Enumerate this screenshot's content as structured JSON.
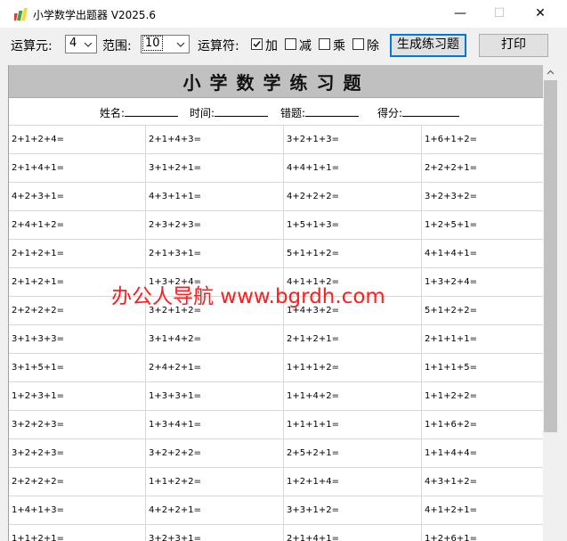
{
  "window": {
    "title": "小学数学出题器 V2025.6",
    "minimize": "—",
    "maximize": "☐",
    "close": "✕"
  },
  "toolbar": {
    "operands_label": "运算元:",
    "operands_value": "4",
    "range_label": "范围:",
    "range_value": "10",
    "operators_label": "运算符:",
    "ops": [
      {
        "label": "加",
        "checked": true
      },
      {
        "label": "减",
        "checked": false
      },
      {
        "label": "乘",
        "checked": false
      },
      {
        "label": "除",
        "checked": false
      }
    ],
    "generate_label": "生成练习题",
    "print_label": "打印"
  },
  "sheet": {
    "title": "小学数学练习题",
    "name_label": "姓名:",
    "time_label": "时间:",
    "errors_label": "错题:",
    "score_label": "得分:",
    "rows": [
      [
        "2+1+2+4=",
        "2+1+4+3=",
        "3+2+1+3=",
        "1+6+1+2="
      ],
      [
        "2+1+4+1=",
        "3+1+2+1=",
        "4+4+1+1=",
        "2+2+2+1="
      ],
      [
        "4+2+3+1=",
        "4+3+1+1=",
        "4+2+2+2=",
        "3+2+3+2="
      ],
      [
        "2+4+1+2=",
        "2+3+2+3=",
        "1+5+1+3=",
        "1+2+5+1="
      ],
      [
        "2+1+2+1=",
        "2+1+3+1=",
        "5+1+1+2=",
        "4+1+4+1="
      ],
      [
        "2+1+2+1=",
        "1+3+2+4=",
        "4+1+1+2=",
        "1+3+2+4="
      ],
      [
        "2+2+2+2=",
        "3+2+1+2=",
        "1+4+3+2=",
        "5+1+2+2="
      ],
      [
        "3+1+3+3=",
        "3+1+4+2=",
        "2+1+2+1=",
        "2+1+1+1="
      ],
      [
        "3+1+5+1=",
        "2+4+2+1=",
        "1+1+1+2=",
        "1+1+1+5="
      ],
      [
        "1+2+3+1=",
        "1+3+3+1=",
        "1+1+4+2=",
        "1+1+2+2="
      ],
      [
        "3+2+2+3=",
        "1+3+4+1=",
        "1+1+1+1=",
        "1+1+6+2="
      ],
      [
        "3+2+2+3=",
        "3+2+2+2=",
        "2+5+2+1=",
        "1+1+4+4="
      ],
      [
        "2+2+2+2=",
        "1+1+2+2=",
        "1+2+1+4=",
        "4+3+1+2="
      ],
      [
        "1+4+1+3=",
        "4+2+2+1=",
        "3+3+1+2=",
        "4+1+2+1="
      ],
      [
        "1+1+2+1=",
        "3+2+3+1=",
        "2+1+4+1=",
        "1+2+6+1="
      ]
    ]
  },
  "watermark": "办公人导航 www.bgrdh.com",
  "colors": {
    "accent": "#0078d7",
    "watermark": "#ff1e1e",
    "banner": "#c0c0c0"
  }
}
